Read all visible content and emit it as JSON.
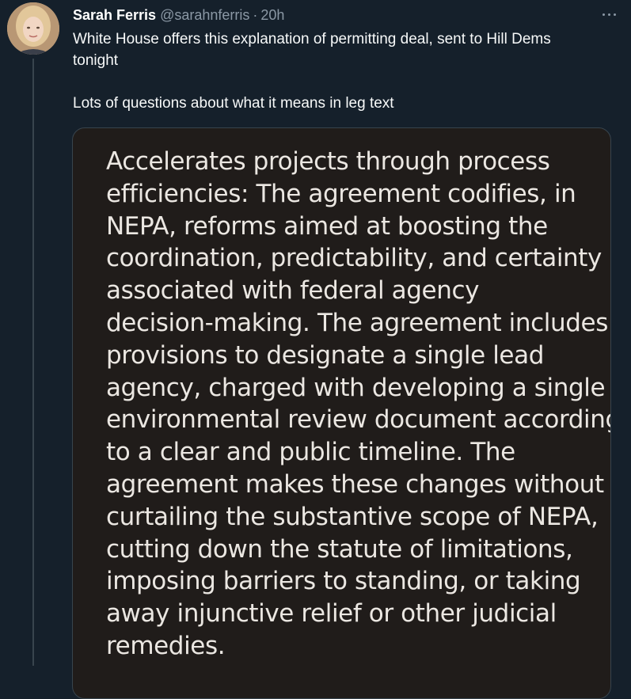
{
  "tweet": {
    "author_name": "Sarah Ferris",
    "author_handle": "@sarahnferris",
    "separator": "·",
    "timestamp": "20h",
    "text_line_1": "White House offers this explanation of permitting deal, sent to Hill Dems",
    "text_line_2": "tonight",
    "text_line_3": "Lots of questions about what it means in leg text"
  },
  "media": {
    "lines": [
      "Accelerates projects through process",
      "efficiencies: The agreement codifies, in",
      "NEPA, reforms aimed at boosting the",
      "coordination, predictability, and certainty",
      "associated with federal agency",
      "decision-making.  The agreement includes",
      "provisions to designate a single lead",
      "agency, charged with developing a single",
      "environmental review document according",
      "to a clear and public timeline.  The",
      "agreement makes these changes without",
      "curtailing the substantive scope of NEPA,",
      "cutting down the statute of limitations,",
      "imposing barriers to standing, or taking",
      "away injunctive relief or other judicial",
      "remedies."
    ]
  },
  "icons": {
    "more": "more-horizontal-icon"
  },
  "colors": {
    "background": "#15202b",
    "secondary_text": "#8b98a5",
    "media_background": "#201c1a",
    "border": "#38444d"
  }
}
